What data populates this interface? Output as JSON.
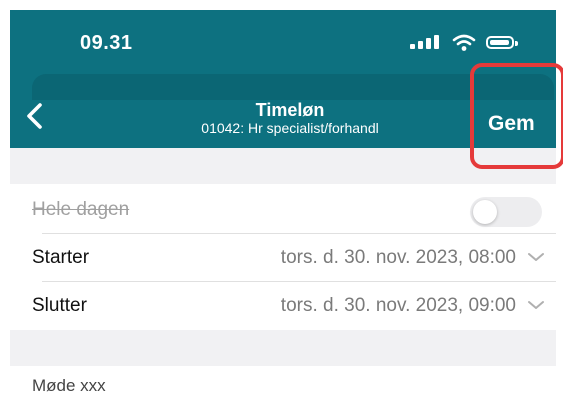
{
  "status_bar": {
    "time": "09.31"
  },
  "header": {
    "title": "Timeløn",
    "subtitle": "01042: Hr specialist/forhandl",
    "save_label": "Gem"
  },
  "form": {
    "all_day": {
      "label": "Hele dagen",
      "value": false
    },
    "start": {
      "label": "Starter",
      "value": "tors. d. 30. nov. 2023, 08:00"
    },
    "end": {
      "label": "Slutter",
      "value": "tors. d. 30. nov. 2023, 09:00"
    },
    "notes": {
      "text": "Møde xxx"
    }
  },
  "colors": {
    "header": "#0d7180",
    "highlight": "#e53a3a",
    "band": "#f1f1f3"
  },
  "icons": [
    "chevron-left-icon",
    "signal-icon",
    "wifi-icon",
    "battery-icon",
    "chevron-down-icon"
  ]
}
